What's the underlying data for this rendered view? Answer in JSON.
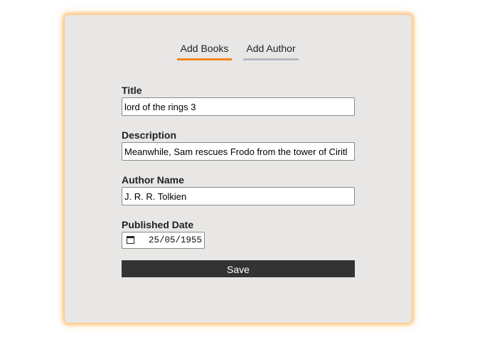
{
  "tabs": [
    {
      "label": "Add Books",
      "active": true
    },
    {
      "label": "Add Author",
      "active": false
    }
  ],
  "form": {
    "title": {
      "label": "Title",
      "value": "lord of the rings 3"
    },
    "description": {
      "label": "Description",
      "value": "Meanwhile, Sam rescues Frodo from the tower of Ciritl"
    },
    "author_name": {
      "label": "Author Name",
      "value": "J. R. R. Tolkien"
    },
    "published_date": {
      "label": "Published Date",
      "value": "25/05/1955"
    }
  },
  "save_label": "Save",
  "colors": {
    "active_tab_underline": "#f0851b",
    "inactive_tab_underline": "#b5b8c2",
    "card_background": "#e9e7e6",
    "save_button": "#333333"
  }
}
